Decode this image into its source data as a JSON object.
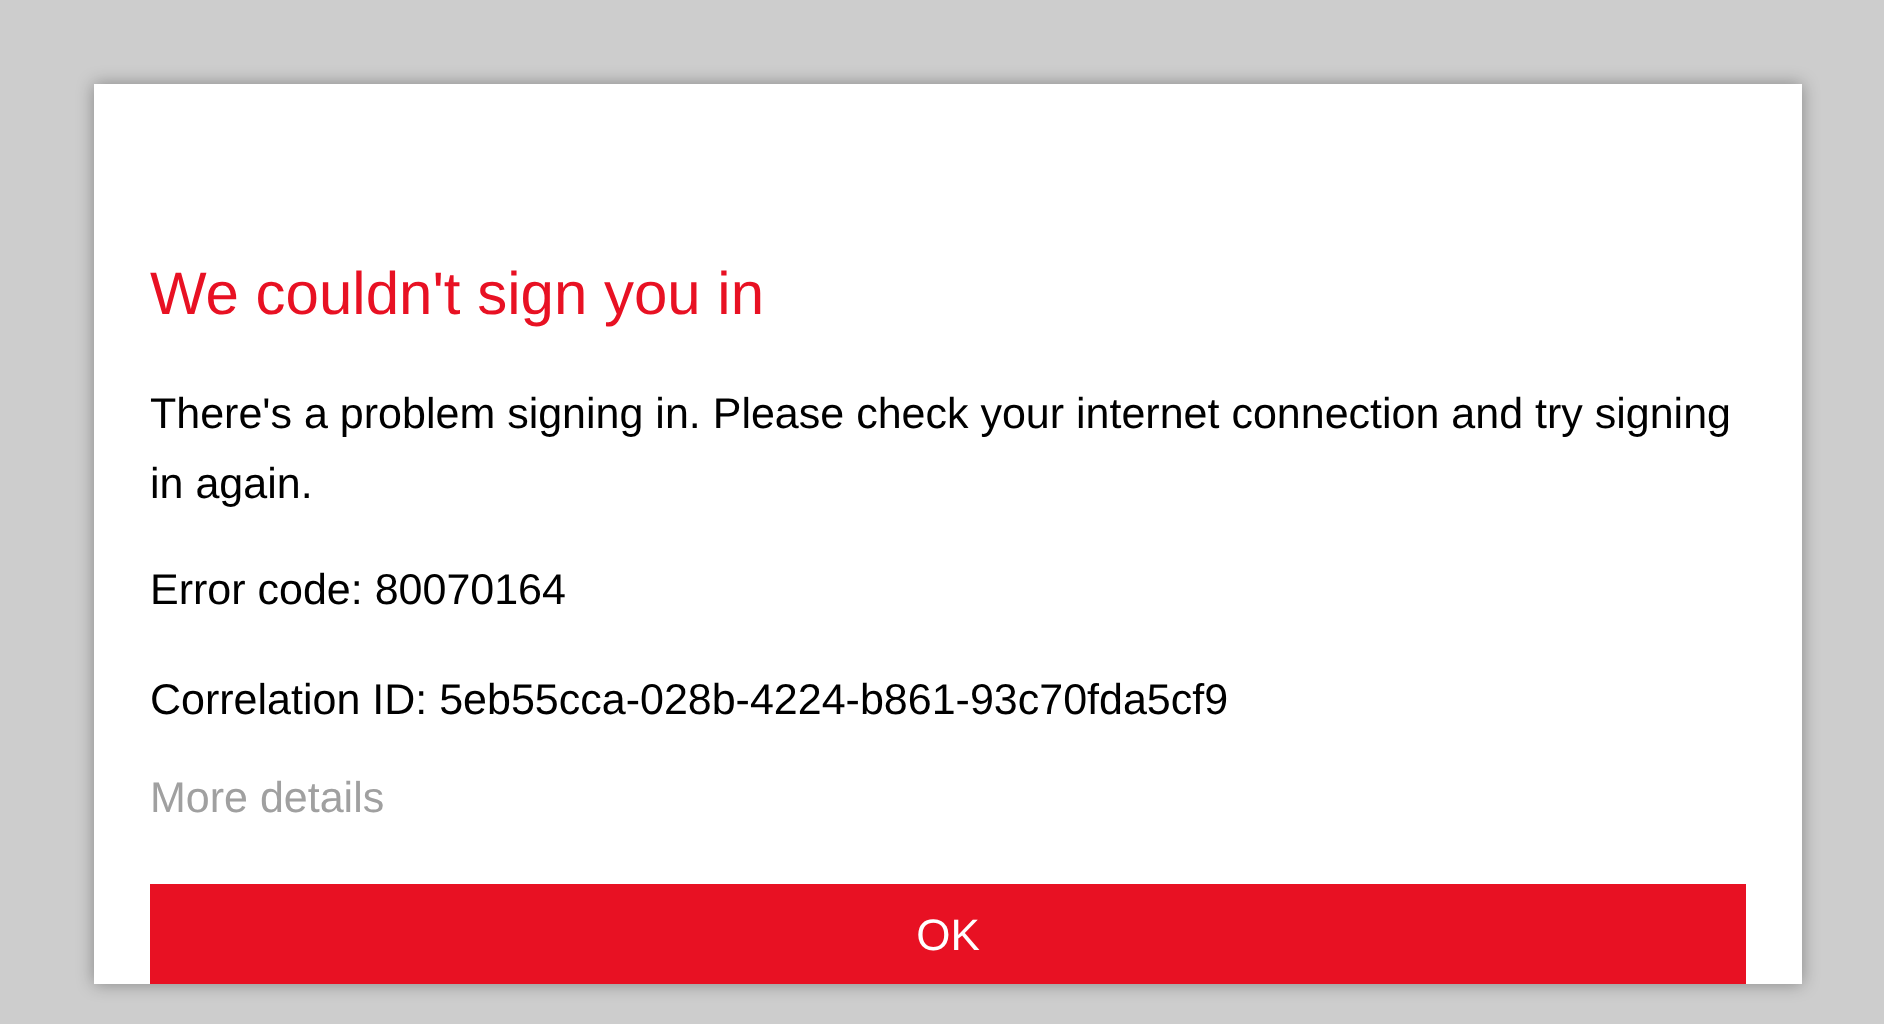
{
  "dialog": {
    "title": "We couldn't sign you in",
    "message": "There's a problem signing in. Please check your internet connection and try signing in again.",
    "details": [
      "Error code: 80070164",
      "Correlation ID: 5eb55cca-028b-4224-b861-93c70fda5cf9"
    ],
    "more_details_link": "More details",
    "buttons": [
      "OK"
    ]
  }
}
